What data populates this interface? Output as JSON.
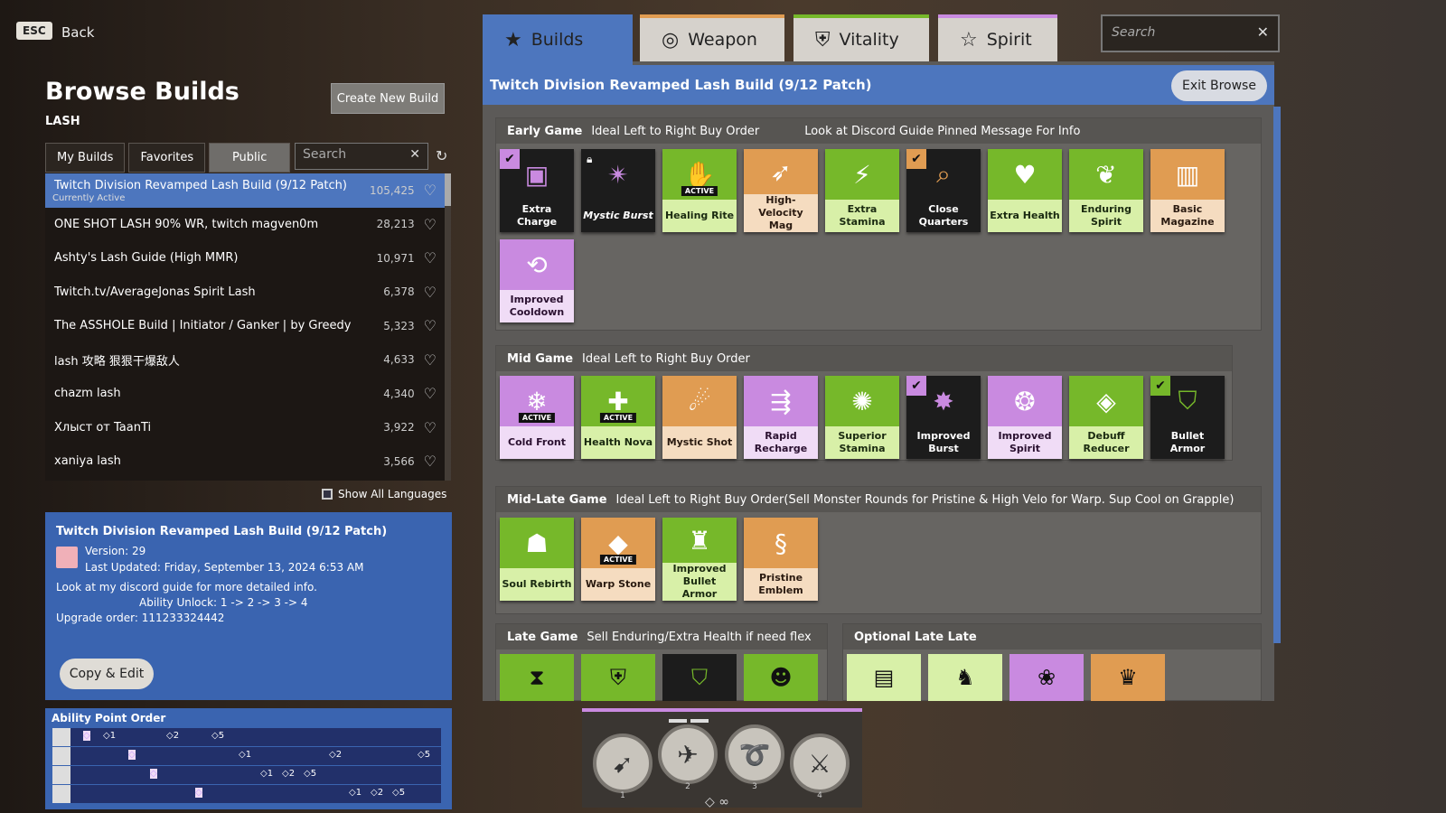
{
  "nav": {
    "esc": "ESC",
    "back": "Back"
  },
  "left": {
    "title": "Browse Builds",
    "hero": "LASH",
    "create_label": "Create New Build",
    "tabs": [
      "My Builds",
      "Favorites",
      "Public"
    ],
    "search_placeholder": "Search",
    "show_all_languages": "Show All Languages",
    "builds": [
      {
        "name": "Twitch Division Revamped Lash Build (9/12 Patch)",
        "count": "105,425",
        "note": "Currently Active"
      },
      {
        "name": "ONE SHOT LASH 90% WR, twitch magven0m",
        "count": "28,213"
      },
      {
        "name": "Ashty's Lash Guide (High MMR)",
        "count": "10,971"
      },
      {
        "name": "Twitch.tv/AverageJonas Spirit Lash",
        "count": "6,378"
      },
      {
        "name": "The ASSHOLE Build | Initiator / Ganker | by Greedy",
        "count": "5,323"
      },
      {
        "name": "lash 攻略 狠狠干爆敌人",
        "count": "4,633"
      },
      {
        "name": "chazm lash",
        "count": "4,340"
      },
      {
        "name": "Хлыст от TaanTi",
        "count": "3,922"
      },
      {
        "name": "xaniya lash",
        "count": "3,566"
      }
    ],
    "details": {
      "title": "Twitch Division Revamped Lash Build (9/12 Patch)",
      "version": "Version: 29",
      "updated": "Last Updated: Friday, September 13, 2024 6:53 AM",
      "desc1": "Look at my discord guide for more detailed info.",
      "desc2": "Ability Unlock: 1 -> 2 -> 3 -> 4",
      "desc3": "Upgrade order: 111233324442",
      "copy_label": "Copy & Edit"
    },
    "ability_order": {
      "title": "Ability Point Order",
      "rows": [
        [
          "◇",
          "◇1",
          "◇2",
          "◇5"
        ],
        [
          "◇",
          "◇1",
          "◇2",
          "◇5"
        ],
        [
          "◇",
          "◇1",
          "◇2",
          "◇5"
        ],
        [
          "◇",
          "◇1",
          "◇2",
          "◇5"
        ]
      ]
    }
  },
  "right": {
    "tabs": [
      {
        "label": "Builds",
        "icon": "★"
      },
      {
        "label": "Weapon",
        "icon": "◎"
      },
      {
        "label": "Vitality",
        "icon": "⛨"
      },
      {
        "label": "Spirit",
        "icon": "☆"
      }
    ],
    "search_placeholder": "Search",
    "build_title": "Twitch Division Revamped Lash Build (9/12 Patch)",
    "exit_label": "Exit Browse",
    "sections": {
      "early": {
        "name": "Early Game",
        "note1": "Ideal Left to Right Buy Order",
        "note2": "Look at Discord Guide  Pinned Message For Info"
      },
      "mid": {
        "name": "Mid Game",
        "note1": "Ideal Left to Right Buy Order"
      },
      "midlate": {
        "name": "Mid-Late Game",
        "note1": "Ideal Left to Right Buy Order(Sell Monster Rounds for Pristine & High Velo for Warp. Sup Cool on Grapple)"
      },
      "late": {
        "name": "Late Game",
        "note1": "Sell Enduring/Extra Health if need flex"
      },
      "optional": {
        "name": "Optional Late Late"
      }
    },
    "early_items": [
      "Extra Charge",
      "Mystic Burst",
      "Healing Rite",
      "High-Velocity Mag",
      "Extra Stamina",
      "Close Quarters",
      "Extra Health",
      "Enduring Spirit",
      "Basic Magazine",
      "Improved Cooldown"
    ],
    "mid_items": [
      "Cold Front",
      "Health Nova",
      "Mystic Shot",
      "Rapid Recharge",
      "Superior Stamina",
      "Improved Burst",
      "Improved Spirit",
      "Debuff Reducer",
      "Bullet Armor"
    ],
    "midlate_items": [
      "Soul Rebirth",
      "Warp Stone",
      "Improved Bullet Armor",
      "Pristine Emblem"
    ],
    "active_badge": "ACTIVE",
    "ability_numbers": [
      "1",
      "2",
      "3",
      "4"
    ]
  }
}
